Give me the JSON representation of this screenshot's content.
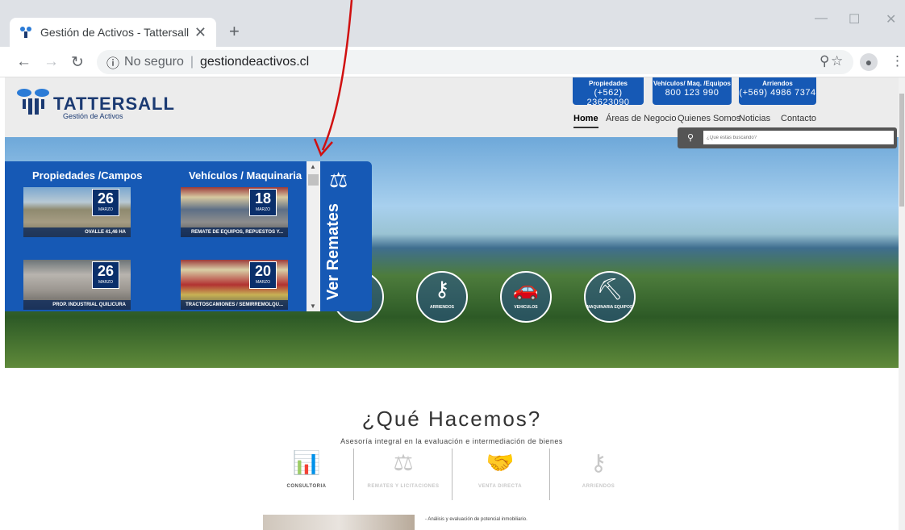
{
  "browser": {
    "tab_title": "Gestión de Activos - Tattersall",
    "tab_close": "✕",
    "new_tab": "+",
    "security": "No seguro",
    "url": "gestiondeactivos.cl"
  },
  "brand": {
    "name": "TATTERSALL",
    "subtitle": "Gestión de Activos"
  },
  "phones": [
    {
      "label": "Propiedades",
      "number": "(+562) 23623090"
    },
    {
      "label": "Vehículos/ Maq. /Equipos",
      "number": "800 123 990"
    },
    {
      "label": "Arriendos",
      "number": "(+569) 4986 7374"
    }
  ],
  "menu": [
    "Home",
    "Áreas de Negocio",
    "Quienes Somos",
    "Noticias",
    "Contacto"
  ],
  "search": {
    "placeholder": "¿Que estás buscando?"
  },
  "hero_circles": [
    "ARRIENDOS",
    "VEHICULOS",
    "MAQUINARIA EQUIPOS"
  ],
  "remates": {
    "col1_title": "Propiedades /Campos",
    "col2_title": "Vehículos / Maquinaria",
    "ver_label": "Ver Remates",
    "items": [
      {
        "day": "26",
        "month": "MARZO",
        "caption": "OVALLE 41,46 HA"
      },
      {
        "day": "18",
        "month": "MARZO",
        "caption": "REMATE DE EQUIPOS, REPUESTOS Y..."
      },
      {
        "day": "26",
        "month": "MARZO",
        "caption": "PROP. INDUSTRIAL QUILICURA"
      },
      {
        "day": "20",
        "month": "MARZO",
        "caption": "TRACTOSCAMIONES / SEMIRREMOLQU..."
      }
    ]
  },
  "que_hacemos": {
    "title": "¿Qué Hacemos?",
    "subtitle": "Asesoría integral en la evaluación e intermediación de bienes",
    "services": [
      "CONSULTORIA",
      "REMATES Y LICITACIONES",
      "VENTA DIRECTA",
      "ARRIENDOS"
    ],
    "detail": "- Análisis y evaluación de potencial inmobiliario."
  },
  "colors": {
    "brand_blue": "#1659b5",
    "annotation_red": "#d01010"
  }
}
